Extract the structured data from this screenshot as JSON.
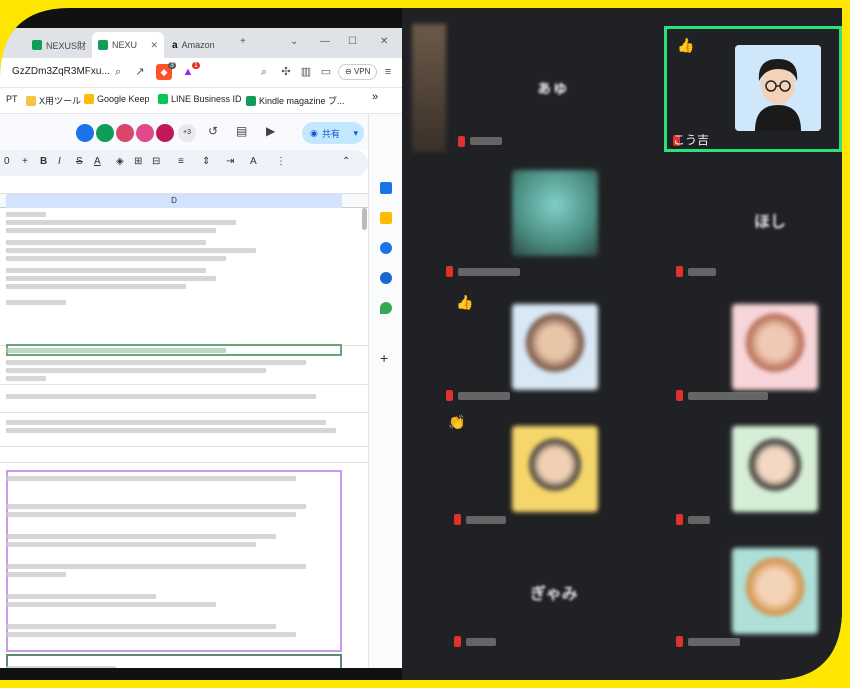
{
  "browser": {
    "tabs": [
      {
        "label": "NEXUS財",
        "favicon_color": "#0f9d58",
        "active": false
      },
      {
        "label": "NEXU",
        "favicon_color": "#0f9d58",
        "active": true
      },
      {
        "label": "Amazon",
        "favicon_color": "#111111",
        "active": false
      }
    ],
    "new_tab": "+",
    "url": "GzZDm3ZqR3MFxu...",
    "bookmarks": [
      "PT",
      "X用ツール",
      "Google Keep",
      "LINE Business ID",
      "Kindle magazine ブ..."
    ],
    "bookmarks_more": "»",
    "avatars_more": "+3",
    "share_label": "共有",
    "zoom_label": "0",
    "column_header": "D",
    "badges": {
      "brave": "3",
      "bat": "1"
    },
    "vpn_label": "VPN"
  },
  "meeting": {
    "participants": [
      {
        "name": "",
        "hand": false
      },
      {
        "name": "こう吉",
        "hand": true
      },
      {
        "name": "",
        "hand": false
      },
      {
        "name": "",
        "hand": false
      },
      {
        "name": "",
        "hand": true
      },
      {
        "name": "",
        "hand": false
      },
      {
        "name": "",
        "hand": true
      },
      {
        "name": "",
        "hand": false
      },
      {
        "name": "",
        "hand": false
      },
      {
        "name": "",
        "hand": false
      }
    ],
    "highlight_color": "#2ee07a"
  }
}
